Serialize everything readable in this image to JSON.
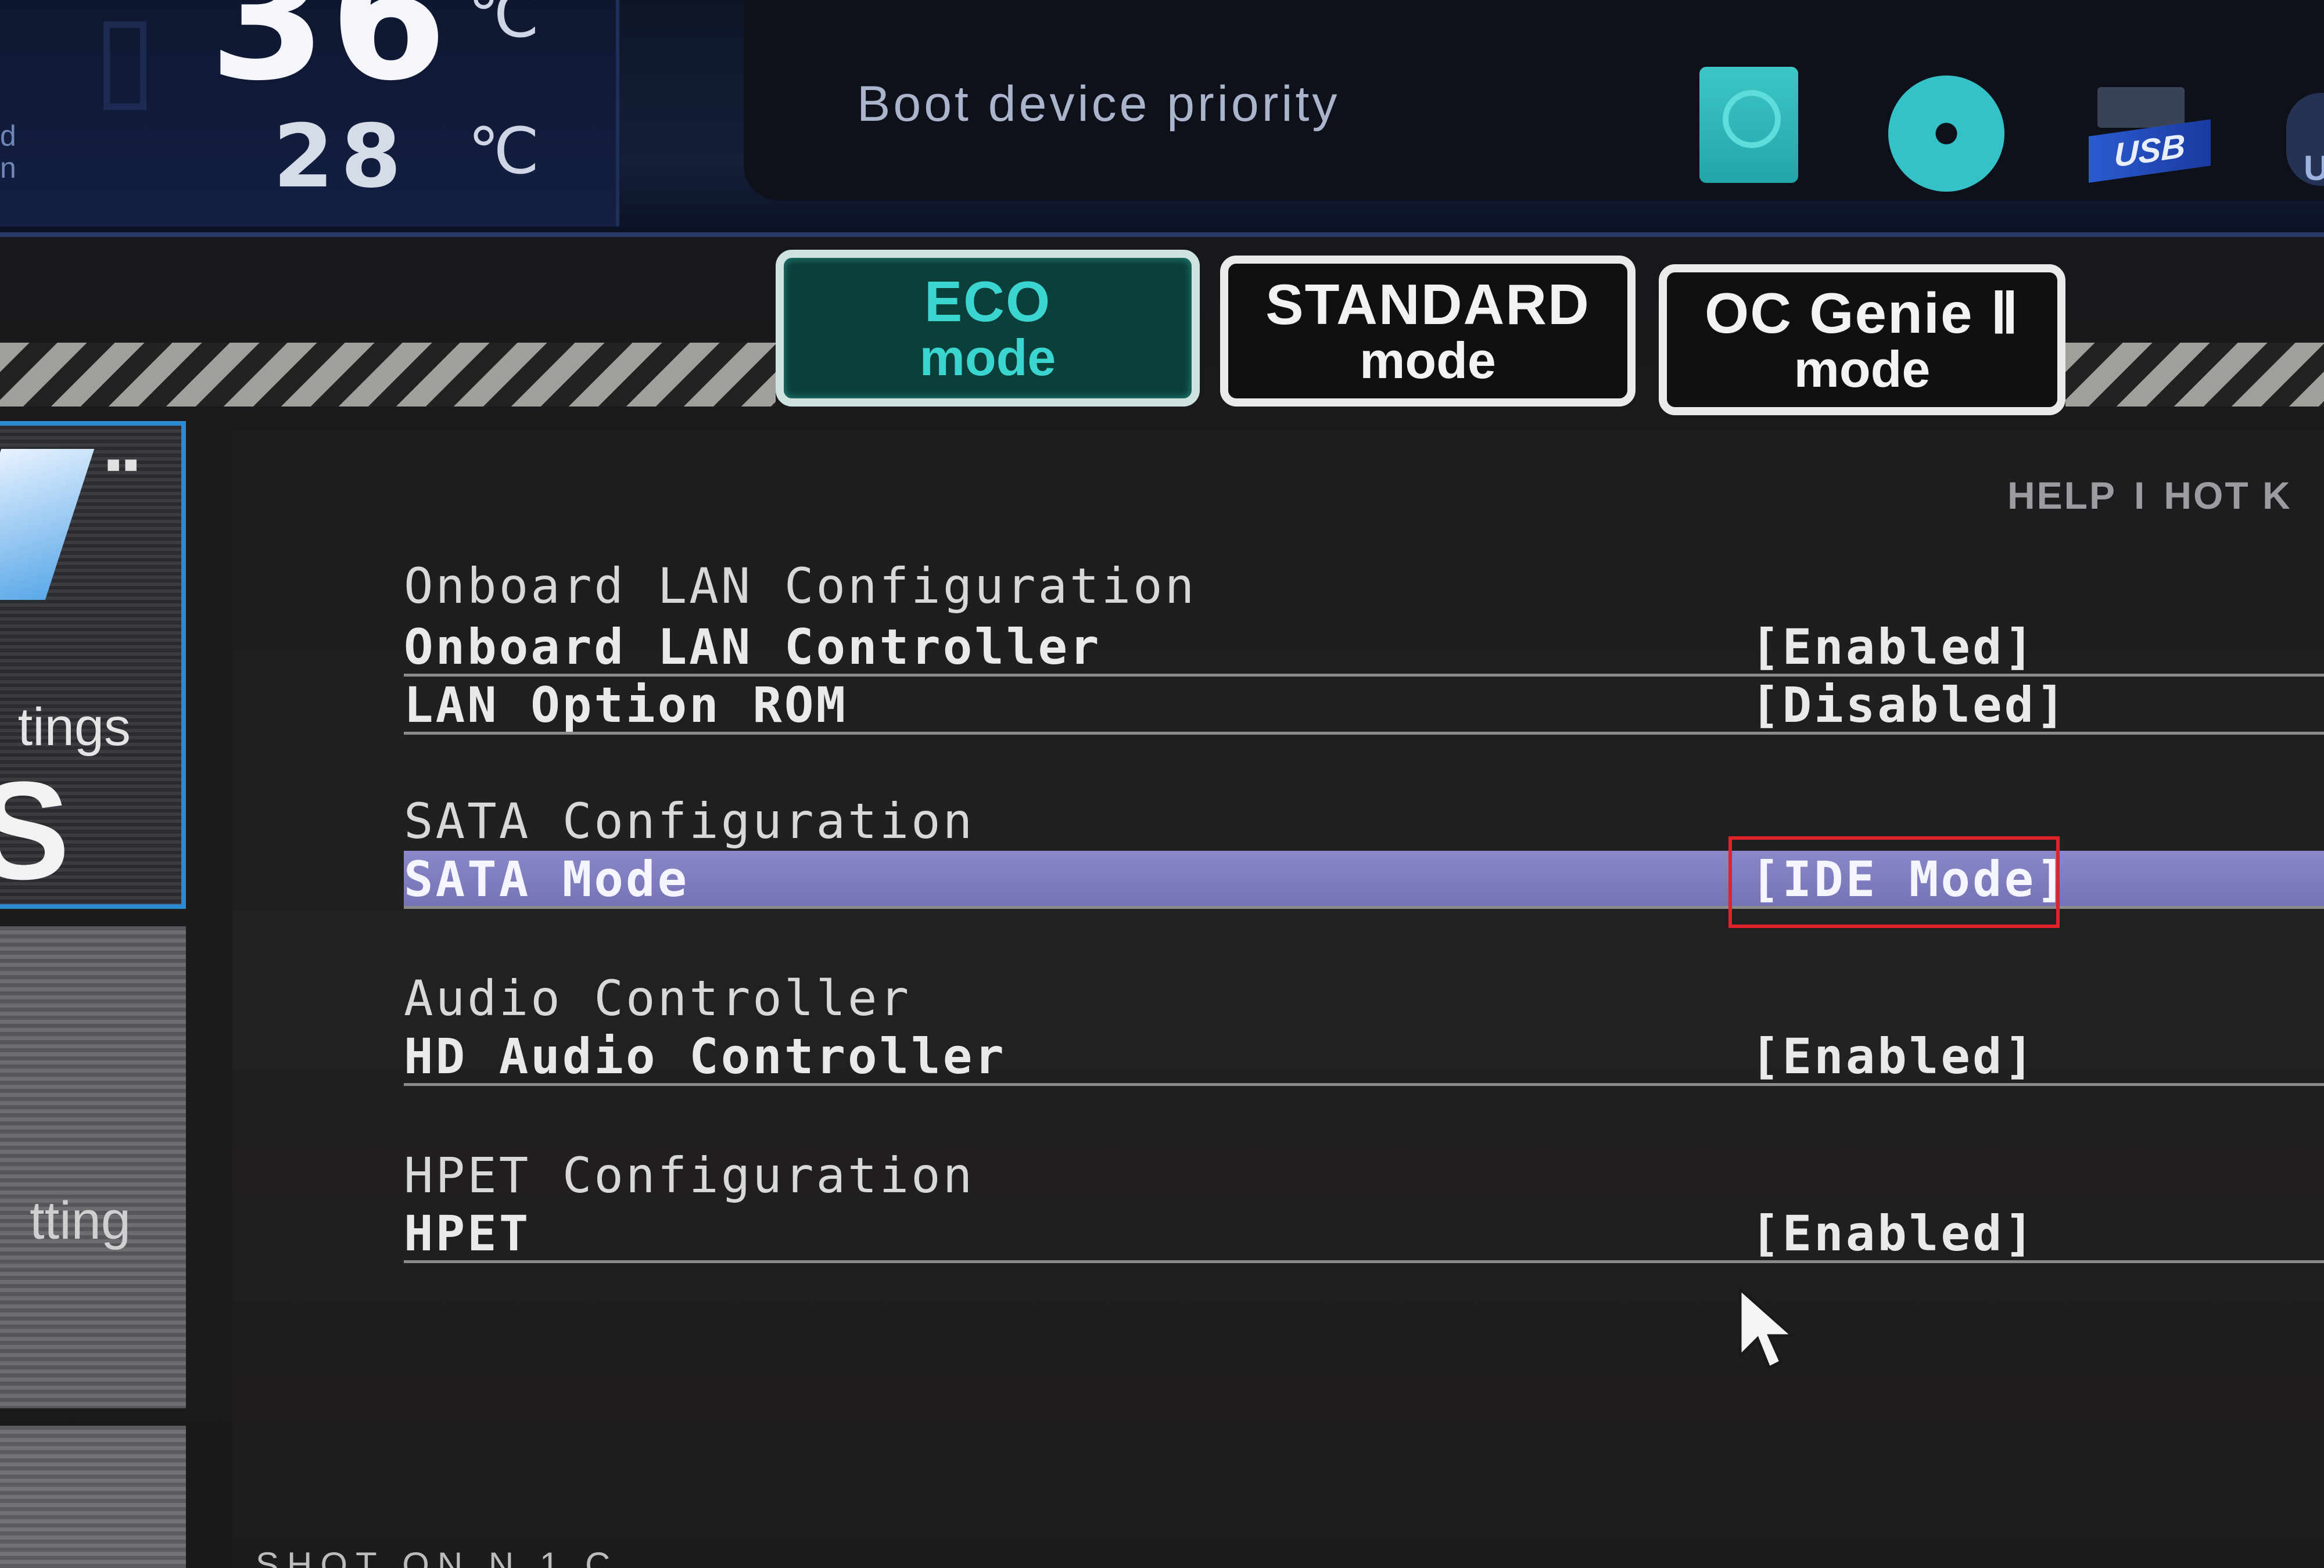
{
  "header": {
    "side_label_top": "d",
    "side_label_bottom": "n",
    "cpu_temp": "36",
    "mb_temp": "28",
    "temp_unit": "℃",
    "boot_title": "Boot device priority",
    "devices": [
      {
        "icon": "hdd-icon",
        "label": ""
      },
      {
        "icon": "optical-disc-icon",
        "label": ""
      },
      {
        "icon": "usb-icon",
        "label": "USB"
      },
      {
        "icon": "usb-icon",
        "label": "U"
      }
    ]
  },
  "modes": [
    {
      "line1": "ECO",
      "line2": "mode",
      "active": true
    },
    {
      "line1": "STANDARD",
      "line2": "mode",
      "active": false
    },
    {
      "line1": "OC Genie Ⅱ",
      "line2": "mode",
      "active": false
    }
  ],
  "sidebar": {
    "items": [
      {
        "label": "tings",
        "big_letter": "S",
        "active": true
      },
      {
        "label": "tting",
        "active": false
      },
      {
        "label": "",
        "active": false
      }
    ]
  },
  "toolbar": {
    "help": "HELP",
    "separator": "I",
    "hotkey": "HOT K"
  },
  "settings": {
    "sections": [
      {
        "title": "Onboard LAN Configuration",
        "rows": [
          {
            "label": "Onboard LAN Controller",
            "value": "[Enabled]"
          },
          {
            "label": "LAN Option ROM",
            "value": "[Disabled]"
          }
        ]
      },
      {
        "title": "SATA Configuration",
        "rows": [
          {
            "label": "SATA Mode",
            "value": "[IDE Mode]",
            "selected": true
          }
        ]
      },
      {
        "title": "Audio Controller",
        "rows": [
          {
            "label": "HD Audio Controller",
            "value": "[Enabled]"
          }
        ]
      },
      {
        "title": "HPET Configuration",
        "rows": [
          {
            "label": "HPET",
            "value": "[Enabled]"
          }
        ]
      }
    ]
  },
  "footer": {
    "partial_text": "SHOT ON N 1 C"
  },
  "colors": {
    "accent_eco": "#3bd5d0",
    "selection": "#8a88c8",
    "highlight_box": "#e0232a"
  }
}
